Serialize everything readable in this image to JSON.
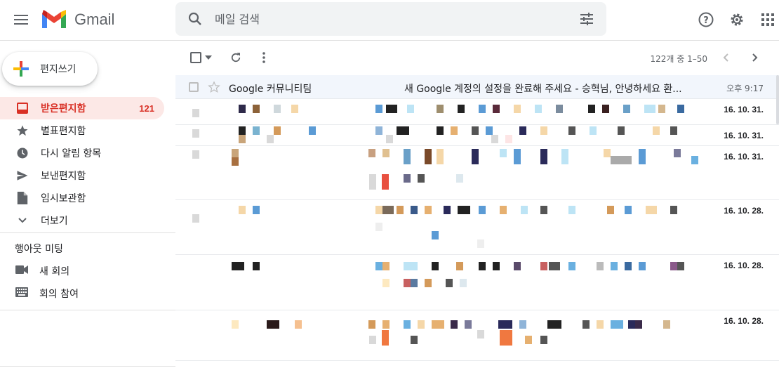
{
  "header": {
    "app_name": "Gmail",
    "search_placeholder": "메일 검색",
    "icons": [
      "menu-icon",
      "gmail-logo-icon",
      "search-icon",
      "tune-icon",
      "help-icon",
      "settings-icon",
      "apps-icon"
    ]
  },
  "sidebar": {
    "compose_label": "편지쓰기",
    "items": [
      {
        "label": "받은편지함",
        "count": "121",
        "icon": "inbox-icon",
        "active": true
      },
      {
        "label": "별표편지함",
        "icon": "star-icon"
      },
      {
        "label": "다시 알림 항목",
        "icon": "clock-icon"
      },
      {
        "label": "보낸편지함",
        "icon": "send-icon"
      },
      {
        "label": "임시보관함",
        "icon": "draft-icon"
      },
      {
        "label": "더보기",
        "icon": "chevron-down-icon"
      }
    ],
    "meet": {
      "title": "행아웃 미팅",
      "items": [
        {
          "label": "새 회의",
          "icon": "video-icon"
        },
        {
          "label": "회의 참여",
          "icon": "keyboard-icon"
        }
      ]
    }
  },
  "toolbar": {
    "pager": "122개 중 1–50"
  },
  "mail": {
    "rows": [
      {
        "sender": "Google 커뮤니티팀",
        "subject": "새 Google 계정의 설정을 완료해 주세요 - 승혁님, 안녕하세요 환...",
        "time": "오후 9:17"
      }
    ],
    "blurred_dates": [
      "16. 10. 31.",
      "16. 10. 31.",
      "16. 10. 31.",
      "16. 10. 28.",
      "16. 10. 28.",
      "16. 10. 28."
    ]
  },
  "colors": {
    "accent": "#d93025",
    "active_bg": "#fce8e6",
    "read_row": "#f2f6fc"
  }
}
